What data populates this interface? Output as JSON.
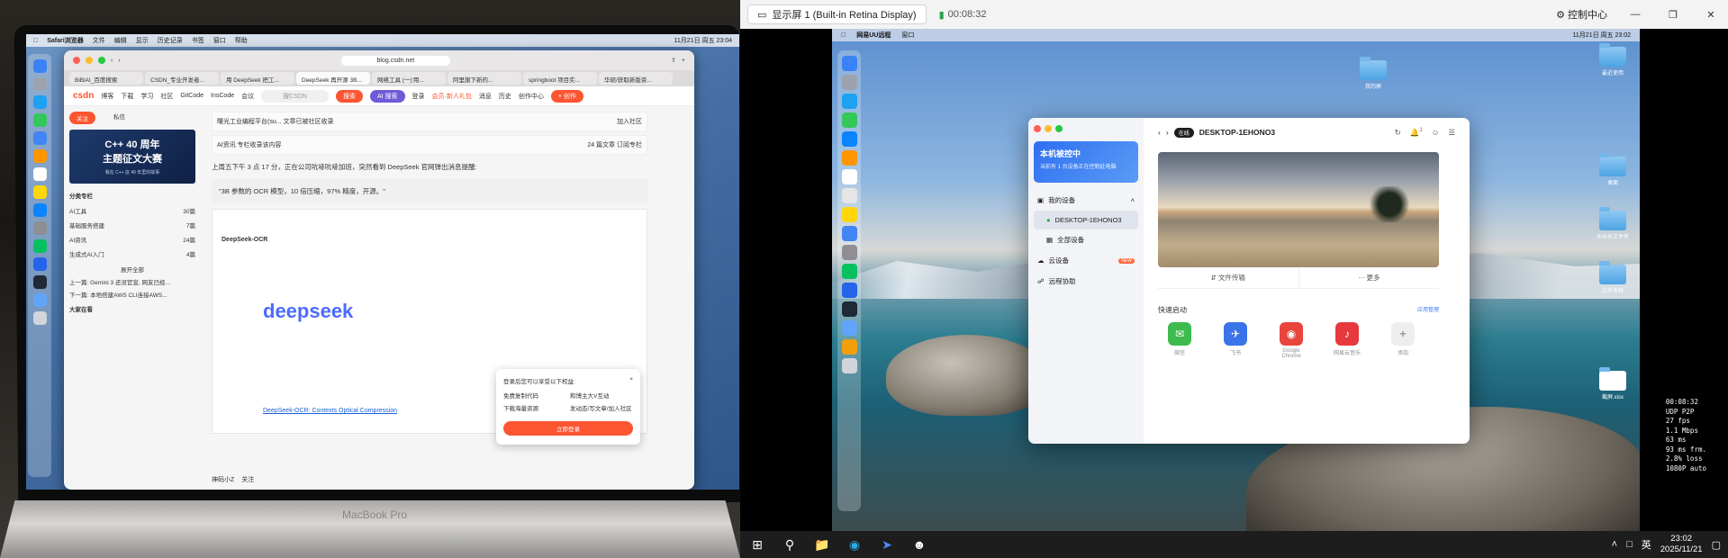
{
  "photo": {
    "mac_menubar": {
      "app": "Safari浏览器",
      "items": [
        "文件",
        "编辑",
        "显示",
        "历史记录",
        "书签",
        "窗口",
        "帮助"
      ],
      "clock": "11月21日 周五 23:04"
    },
    "browser": {
      "address": "blog.csdn.net",
      "tabs": [
        "BiBiAI_百度搜索",
        "CSDN_专业开发者...",
        "用 DeepSeek 把工...",
        "DeepSeek 再开源 3B...",
        "网络工具 (一)'用...",
        "阿里旗下新的...",
        "springboot 项目实...",
        "华硕/获取新版资..."
      ],
      "csdn_logo": "csdn",
      "nav": [
        "博客",
        "下载",
        "学习",
        "社区",
        "GitCode",
        "InsCode",
        "会议"
      ],
      "search_placeholder": "搜CSDN",
      "search_btn": "搜索",
      "ai_btn": "AI 搜索",
      "login": "登录",
      "vip": "会员·新人礼包",
      "msg": "消息",
      "history": "历史",
      "creation": "创作中心",
      "publish": "+ 创作"
    },
    "left_col": {
      "follow": "关注",
      "dm": "私信",
      "banner_title": "C++ 40 周年\n主题征文大赛",
      "banner_sub": "我在 C++ 这 40 年里的故事",
      "category_head": "分类专栏",
      "categories": [
        {
          "name": "AI工具",
          "count": "30篇"
        },
        {
          "name": "基础服务搭建",
          "count": "7篇"
        },
        {
          "name": "AI资讯",
          "count": "24篇"
        },
        {
          "name": "生成式AI入门",
          "count": "4篇"
        }
      ],
      "expand": "展开全部",
      "prev": "上一篇: Gemini 3 还没官宣, 网友已经...",
      "next": "下一篇: 本地搭建AWS CLI连接AWS...",
      "big_h": "大家在看"
    },
    "main": {
      "card1": "曙光工业编程平台(su...  文章已被社区收录",
      "card1_btn": "加入社区",
      "card2": "AI资讯  专栏收录该内容",
      "card2_meta": "24 篇文章",
      "card2_btn": "订阅专栏",
      "para": "上周五下午 3 点 17 分，正在公司吭哧吭哧加班，突然看到 DeepSeek 官网弹出消息提醒:",
      "quote": "\"3B 参数的 OCR 模型，10 倍压缩，97% 精度，开源。\"",
      "hf_title": "DeepSeek-OCR",
      "deepseek": "deepseek",
      "hf_link": "DeepSeek-OCR: Contexts Optical Compression",
      "popup_title": "登录后您可以享受以下权益:",
      "popup_items": [
        "免费复制代码",
        "和博主大V互动",
        "下载海量资源",
        "发动态/写文章/加入社区"
      ],
      "popup_btn": "立即登录",
      "author": "神码小Z",
      "author_follow": "关注"
    },
    "label": "MacBook Pro"
  },
  "remote": {
    "title": "显示屏 1 (Built-in Retina Display)",
    "timer": "00:08:32",
    "control": "控制中心",
    "menubar": {
      "app": "网易UU远程",
      "window": "窗口",
      "clock": "11月21日 周五 23:02"
    },
    "desktop_icons": [
      {
        "label": "我的屏"
      },
      {
        "label": "最近使用"
      },
      {
        "label": "桌面"
      },
      {
        "label": "未命名文件夹"
      },
      {
        "label": "文件名称"
      },
      {
        "label": "截屏.xlsx"
      }
    ],
    "uu": {
      "card_title": "本机被控中",
      "card_sub": "当前有 1 台设备正在控制此电脑",
      "my_devices": "我的设备",
      "device": "DESKTOP-1EHONO3",
      "all_devices": "全部设备",
      "cloud": "云设备",
      "cloud_tag": "NEW",
      "assist": "远程协助",
      "online": "在线",
      "head_device": "DESKTOP-1EHONO3",
      "badge": "1",
      "file_transfer": "文件传输",
      "more": "更多",
      "quick": "快速启动",
      "manage": "应用管理",
      "apps": [
        {
          "name": "微信",
          "color": "#3dbb4f",
          "glyph": "✉"
        },
        {
          "name": "飞书",
          "color": "#3b73e8",
          "glyph": "✈"
        },
        {
          "name": "Google\nChrome",
          "color": "#e8453c",
          "glyph": "◉"
        },
        {
          "name": "网易云音乐",
          "color": "#e6393e",
          "glyph": "♪"
        },
        {
          "name": "添加",
          "color": "#eeeeee",
          "glyph": "+"
        }
      ]
    },
    "stats": [
      "00:08:32",
      "UDP P2P",
      "27 fps",
      "1.1 Mbps",
      "63 ms",
      "93 ms frm.",
      "2.8% loss",
      "1080P auto"
    ],
    "taskbar": {
      "ime": "英",
      "time": "23:02",
      "date": "2025/11/21"
    }
  }
}
